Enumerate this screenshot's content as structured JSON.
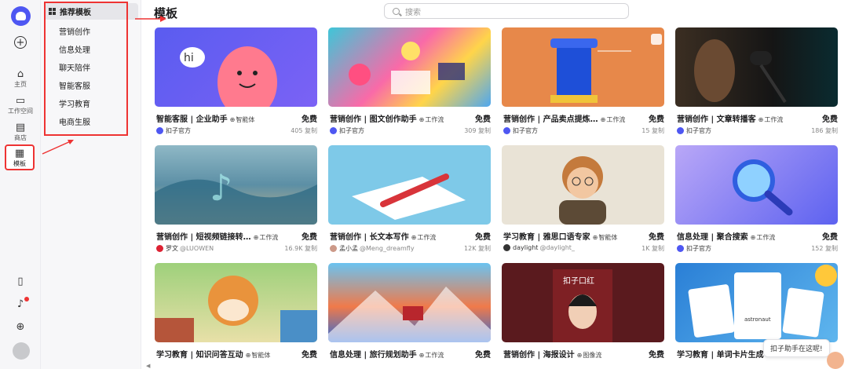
{
  "rail": {
    "items": [
      {
        "label": "主页",
        "icon": "home-icon"
      },
      {
        "label": "工作空间",
        "icon": "terminal-icon"
      },
      {
        "label": "商店",
        "icon": "store-icon"
      },
      {
        "label": "模板",
        "icon": "template-icon"
      }
    ]
  },
  "sidebar": {
    "header": "推荐模板",
    "items": [
      "营销创作",
      "信息处理",
      "聊天陪伴",
      "智能客服",
      "学习教育",
      "电商生服"
    ]
  },
  "main": {
    "title": "模板",
    "search_placeholder": "搜索"
  },
  "cards": [
    {
      "title": "智能客服 | 企业助手",
      "tag": "智能体",
      "price": "免费",
      "author": "扣子官方",
      "handle": "",
      "uses": "405 复制"
    },
    {
      "title": "营销创作 | 图文创作助手",
      "tag": "工作流",
      "price": "免费",
      "author": "扣子官方",
      "handle": "",
      "uses": "309 复制"
    },
    {
      "title": "营销创作 | 产品卖点提炼…",
      "tag": "工作流",
      "price": "免费",
      "author": "扣子官方",
      "handle": "",
      "uses": "15 复制"
    },
    {
      "title": "营销创作 | 文章转播客",
      "tag": "工作流",
      "price": "免费",
      "author": "扣子官方",
      "handle": "",
      "uses": "186 复制"
    },
    {
      "title": "营销创作 | 短视频链接转…",
      "tag": "工作流",
      "price": "免费",
      "author": "罗文",
      "handle": "@LUOWEN",
      "uses": "16.9K 复制"
    },
    {
      "title": "营销创作 | 长文本写作",
      "tag": "工作流",
      "price": "免费",
      "author": "孟小孟",
      "handle": "@Meng_dreamfly",
      "uses": "12K 复制"
    },
    {
      "title": "学习教育 | 雅思口语专家",
      "tag": "智能体",
      "price": "免费",
      "author": "daylight",
      "handle": "@daylight_",
      "uses": "1K 复制"
    },
    {
      "title": "信息处理 | 聚合搜索",
      "tag": "工作流",
      "price": "免费",
      "author": "扣子官方",
      "handle": "",
      "uses": "152 复制"
    },
    {
      "title": "学习教育 | 知识问答互动",
      "tag": "智能体",
      "price": "免费",
      "author": "",
      "handle": "",
      "uses": ""
    },
    {
      "title": "信息处理 | 旅行规划助手",
      "tag": "工作流",
      "price": "免费",
      "author": "",
      "handle": "",
      "uses": ""
    },
    {
      "title": "营销创作 | 海报设计",
      "tag": "图像流",
      "price": "免费",
      "author": "",
      "handle": "",
      "uses": ""
    },
    {
      "title": "学习教育 | 单词卡片生成",
      "tag": "",
      "price": "",
      "author": "",
      "handle": "",
      "uses": ""
    }
  ],
  "images": {
    "hi_text": "hi",
    "poster_text": "扣子口红",
    "card_word": "astronaut"
  },
  "helper": {
    "text": "扣子助手在这呢!"
  },
  "colors": {
    "accent": "#4e57f2",
    "annotation": "#e33333"
  }
}
